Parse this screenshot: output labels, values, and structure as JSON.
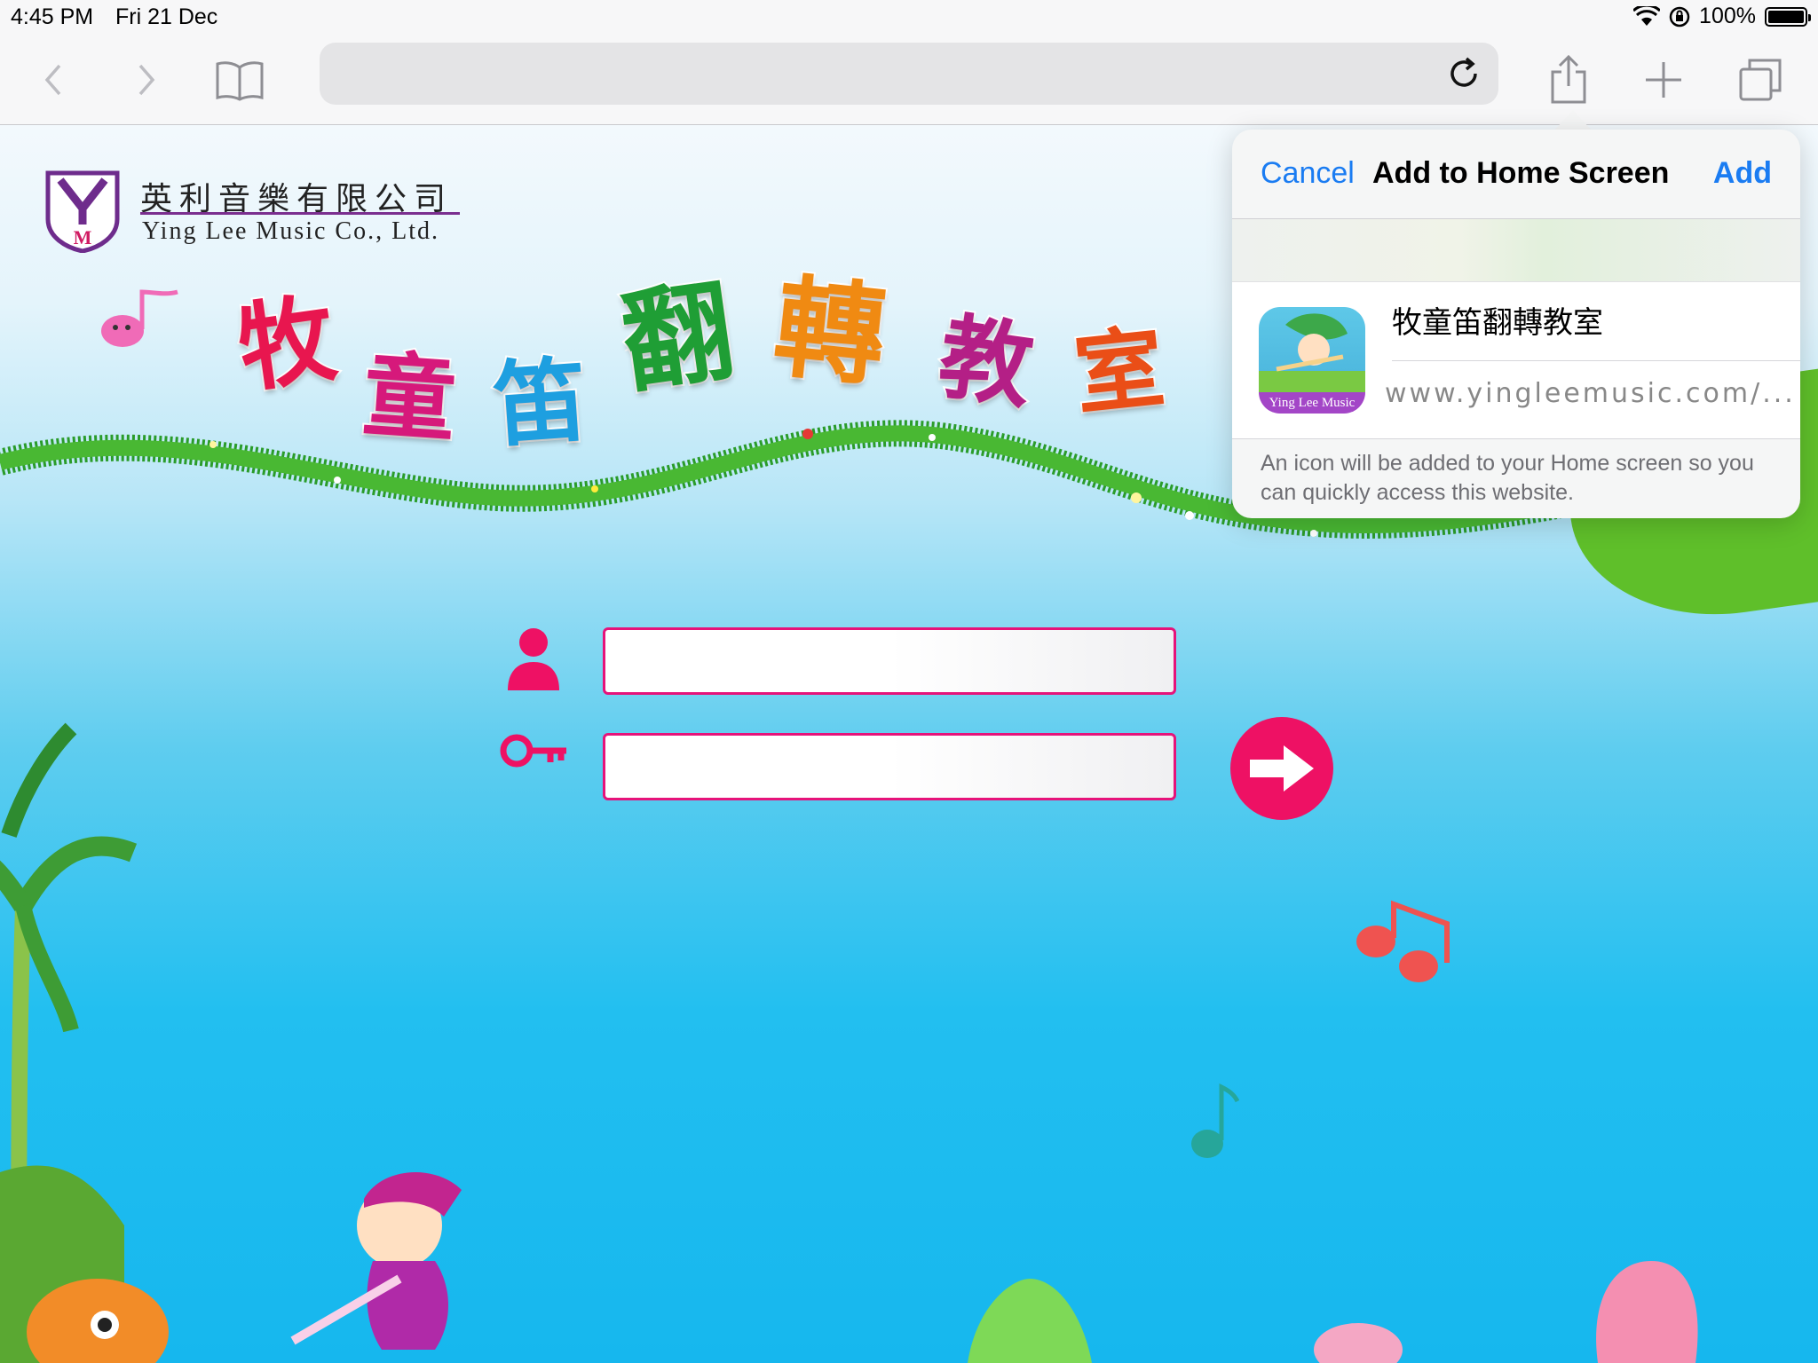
{
  "status_bar": {
    "time": "4:45 PM",
    "date": "Fri 21 Dec",
    "battery": "100%"
  },
  "toolbar": {
    "icons": [
      "back-chevron-icon",
      "forward-chevron-icon",
      "bookmarks-book-icon",
      "reload-icon",
      "share-icon",
      "new-tab-plus-icon",
      "tabs-icon"
    ],
    "url_value": ""
  },
  "page": {
    "company_cn": "英利音樂有限公司",
    "company_en": "Ying Lee Music Co., Ltd.",
    "logo_letters": "YM",
    "title_chars": [
      {
        "char": "牧",
        "color": "#e8164f"
      },
      {
        "char": "童",
        "color": "#d6197b"
      },
      {
        "char": "笛",
        "color": "#1e9fe0"
      },
      {
        "char": "翻",
        "color": "#1f9e35"
      },
      {
        "char": "轉",
        "color": "#f08a12"
      },
      {
        "char": "教",
        "color": "#b41f86"
      },
      {
        "char": "室",
        "color": "#ea4e17"
      }
    ],
    "username_value": "",
    "password_value": "",
    "accent": "#ee1164"
  },
  "popover": {
    "cancel": "Cancel",
    "title": "Add to Home Screen",
    "add": "Add",
    "app_name": "牧童笛翻轉教室",
    "icon_caption": "Ying Lee Music",
    "url": "www.yingleemusic.com/...",
    "footer": "An icon will be added to your Home screen so you can quickly access this website."
  }
}
